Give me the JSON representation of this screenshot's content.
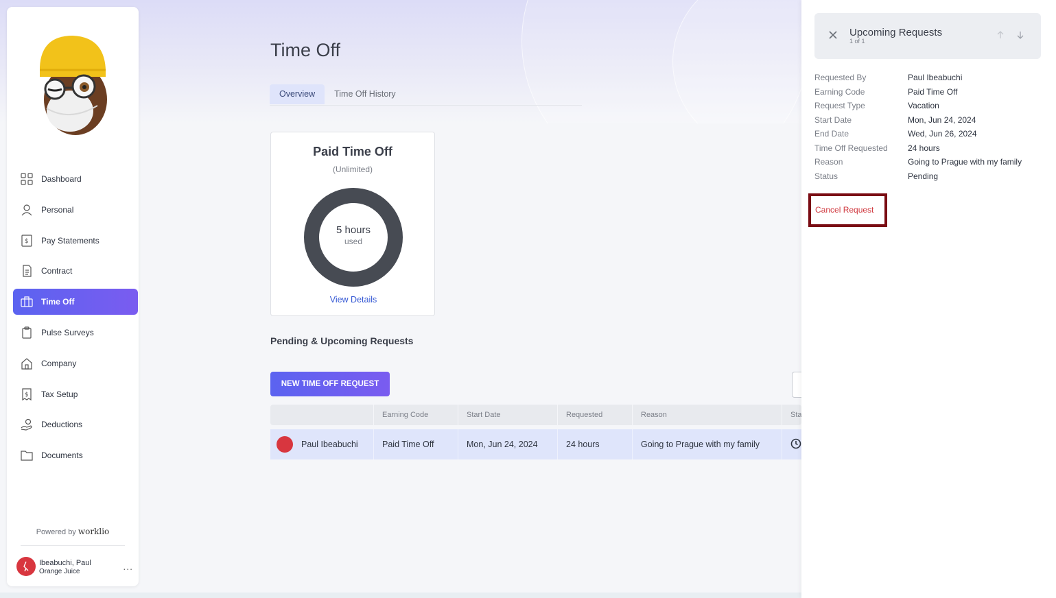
{
  "sidebar": {
    "nav": [
      {
        "label": "Dashboard",
        "icon": "dashboard-grid-icon"
      },
      {
        "label": "Personal",
        "icon": "person-icon"
      },
      {
        "label": "Pay Statements",
        "icon": "dollar-document-icon"
      },
      {
        "label": "Contract",
        "icon": "contract-document-icon"
      },
      {
        "label": "Time Off",
        "icon": "briefcase-icon",
        "active": true
      },
      {
        "label": "Pulse Surveys",
        "icon": "clipboard-icon"
      },
      {
        "label": "Company",
        "icon": "home-icon"
      },
      {
        "label": "Tax Setup",
        "icon": "tax-receipt-icon"
      },
      {
        "label": "Deductions",
        "icon": "hand-dollar-icon"
      },
      {
        "label": "Documents",
        "icon": "folder-icon"
      }
    ],
    "powered_by": "Powered by",
    "brand": "worklio",
    "user": {
      "name": "Ibeabuchi, Paul",
      "company": "Orange Juice",
      "more": "..."
    }
  },
  "main": {
    "title": "Time Off",
    "tabs": [
      {
        "label": "Overview",
        "active": true
      },
      {
        "label": "Time Off History"
      }
    ],
    "pto_card": {
      "title": "Paid Time Off",
      "subtitle": "(Unlimited)",
      "value": "5 hours",
      "unit": "used",
      "link": "View Details"
    },
    "section_title": "Pending & Upcoming Requests",
    "new_request_button": "NEW TIME OFF REQUEST",
    "table": {
      "headers": [
        "",
        "Earning Code",
        "Start Date",
        "Requested",
        "Reason",
        "Sta"
      ],
      "rows": [
        {
          "name": "Paul Ibeabuchi",
          "earning_code": "Paid Time Off",
          "start_date": "Mon, Jun 24, 2024",
          "requested": "24 hours",
          "reason": "Going to Prague with my family",
          "status_icon": "clock-icon"
        }
      ]
    }
  },
  "panel": {
    "title": "Upcoming Requests",
    "count": "1 of 1",
    "details": [
      {
        "key": "Requested By",
        "value": "Paul Ibeabuchi"
      },
      {
        "key": "Earning Code",
        "value": "Paid Time Off"
      },
      {
        "key": "Request Type",
        "value": "Vacation"
      },
      {
        "key": "Start Date",
        "value": "Mon, Jun 24, 2024"
      },
      {
        "key": "End Date",
        "value": "Wed, Jun 26, 2024"
      },
      {
        "key": "Time Off Requested",
        "value": "24 hours"
      },
      {
        "key": "Reason",
        "value": "Going to Prague with my family"
      },
      {
        "key": "Status",
        "value": "Pending"
      }
    ],
    "cancel_button": "Cancel Request"
  },
  "colors": {
    "accent": "#5b63f0",
    "donut": "#474b53",
    "danger": "#d0393f",
    "highlight_border": "#7a0c14"
  }
}
